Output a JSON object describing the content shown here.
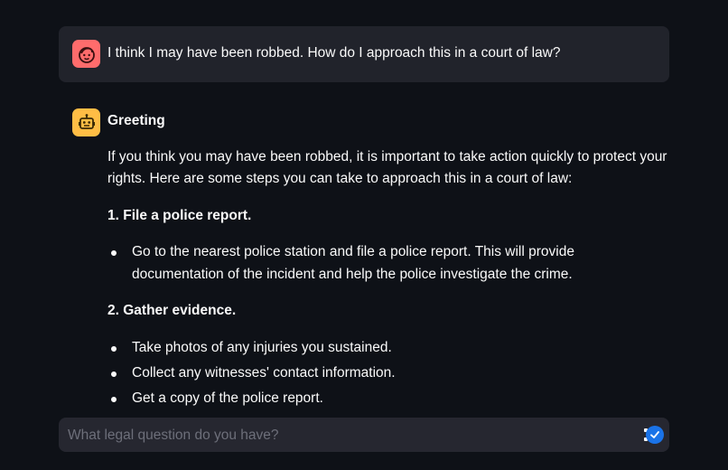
{
  "chat": {
    "user_message": {
      "avatar_icon": "user-face-icon",
      "avatar_color": "#ff6c6c",
      "text": "I think I may have been robbed. How do I approach this in a court of law?"
    },
    "assistant_message": {
      "avatar_icon": "robot-icon",
      "avatar_color": "#ffbd45",
      "title": "Greeting",
      "intro": "If you think you may have been robbed, it is important to take action quickly to protect your rights. Here are some steps you can take to approach this in a court of law:",
      "sections": [
        {
          "heading": "1. File a police report.",
          "bullets": [
            "Go to the nearest police station and file a police report. This will provide documentation of the incident and help the police investigate the crime."
          ]
        },
        {
          "heading": "2. Gather evidence.",
          "bullets": [
            "Take photos of any injuries you sustained.",
            "Collect any witnesses' contact information.",
            "Get a copy of the police report."
          ]
        }
      ]
    }
  },
  "input": {
    "placeholder": "What legal question do you have?",
    "value": "",
    "send_icon": "checkmark-icon",
    "send_color": "#1a73e8"
  },
  "colors": {
    "background": "#0e1117",
    "message_bg": "#262730",
    "text": "#fafafa"
  }
}
